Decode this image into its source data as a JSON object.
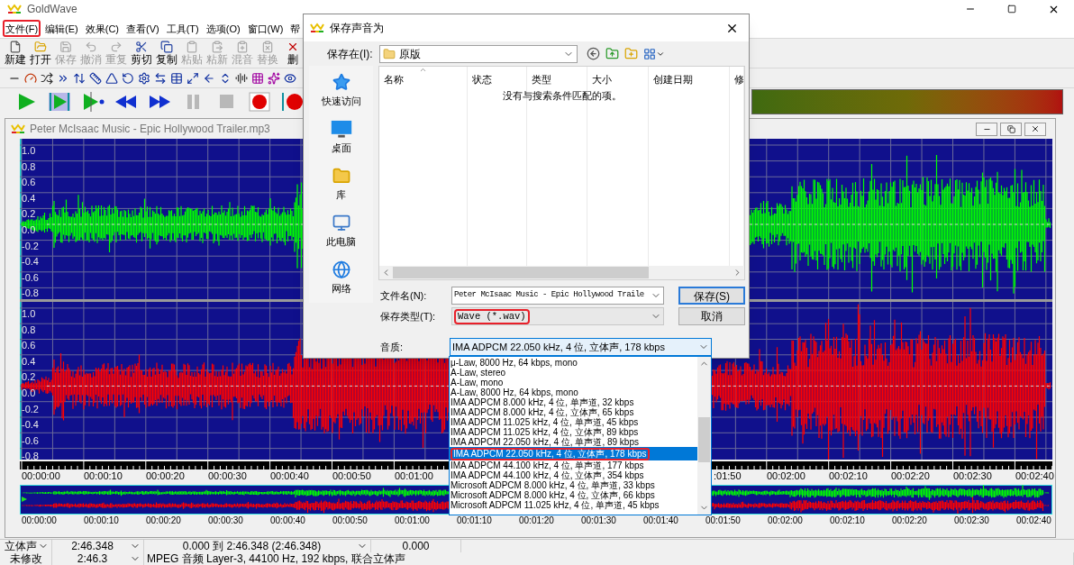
{
  "app": {
    "title": "GoldWave"
  },
  "menu": [
    {
      "label": "文件(F)",
      "circled": true
    },
    {
      "label": "编辑(E)",
      "circled": false
    },
    {
      "label": "效果(C)",
      "circled": false
    },
    {
      "label": "查看(V)",
      "circled": false
    },
    {
      "label": "工具(T)",
      "circled": false
    },
    {
      "label": "选项(O)",
      "circled": false
    },
    {
      "label": "窗口(W)",
      "circled": false
    },
    {
      "label": "帮",
      "circled": false
    }
  ],
  "toolbar": [
    {
      "label": "新建",
      "disabled": false
    },
    {
      "label": "打开",
      "disabled": false
    },
    {
      "label": "保存",
      "disabled": true
    },
    {
      "label": "撤消",
      "disabled": true
    },
    {
      "label": "重复",
      "disabled": true
    },
    {
      "label": "剪切",
      "disabled": false
    },
    {
      "label": "复制",
      "disabled": false
    },
    {
      "label": "粘贴",
      "disabled": true
    },
    {
      "label": "粘新",
      "disabled": true
    },
    {
      "label": "混音",
      "disabled": true
    },
    {
      "label": "替换",
      "disabled": true
    },
    {
      "label": "删",
      "disabled": false
    }
  ],
  "transport": [
    {
      "kind": "play",
      "disabled": false
    },
    {
      "kind": "play-selection",
      "disabled": false
    },
    {
      "kind": "play-from-cursor",
      "disabled": false
    },
    {
      "kind": "rewind",
      "disabled": false
    },
    {
      "kind": "fast-forward",
      "disabled": false
    },
    {
      "kind": "pause",
      "disabled": true
    },
    {
      "kind": "stop",
      "disabled": true
    },
    {
      "kind": "record",
      "disabled": false
    },
    {
      "kind": "record-selection",
      "disabled": false
    }
  ],
  "document": {
    "title": "Peter McIsaac Music - Epic Hollywood Trailer.mp3",
    "channels": [
      {
        "color": "#00ff00",
        "axis": [
          "1.0",
          "0.8",
          "0.6",
          "0.4",
          "0.2",
          "0.0",
          "-0.2",
          "-0.4",
          "-0.6",
          "-0.8"
        ]
      },
      {
        "color": "#ff0000",
        "axis": [
          "1.0",
          "0.8",
          "0.6",
          "0.4",
          "0.2",
          "0.0",
          "-0.2",
          "-0.4",
          "-0.6",
          "-0.8"
        ]
      }
    ],
    "timeline_left": [
      "00:00:00",
      "00:00:10",
      "00:00:20",
      "00:00:30",
      "00:00:40",
      "00:00:50",
      "00:01:00"
    ],
    "timeline_right": [
      ":01:50",
      "00:02:00",
      "00:02:10",
      "00:02:20",
      "00:02:30",
      "00:02:40"
    ],
    "overview_timeline": [
      "00:00:00",
      "00:00:10",
      "00:00:20",
      "00:00:30",
      "00:00:40",
      "00:00:50",
      "00:01:00",
      "00:01:10",
      "00:01:20",
      "00:01:30",
      "00:01:40",
      "00:01:50",
      "00:02:00",
      "00:02:10",
      "00:02:20",
      "00:02:30",
      "00:02:40"
    ]
  },
  "dialog": {
    "title": "保存声音为",
    "save_in": {
      "label": "保存在(I):",
      "value": "原版"
    },
    "places": [
      "快速访问",
      "桌面",
      "库",
      "此电脑",
      "网络"
    ],
    "columns": [
      "名称",
      "状态",
      "类型",
      "大小",
      "创建日期",
      "修"
    ],
    "empty_message": "没有与搜索条件匹配的项。",
    "file_name": {
      "label": "文件名(N):",
      "value": "Peter McIsaac Music - Epic Hollywood Traile"
    },
    "file_type": {
      "label": "保存类型(T):",
      "value": "Wave (*.wav)",
      "circled": true
    },
    "quality": {
      "label": "音质:",
      "value": "IMA ADPCM 22.050 kHz, 4 位, 立体声, 178 kbps"
    },
    "buttons": [
      {
        "label": "保存(S)",
        "default": true
      },
      {
        "label": "取消",
        "default": false
      }
    ],
    "quality_options": [
      {
        "label": "μ-Law, 8000 Hz, 64 kbps, mono",
        "selected": false,
        "circled": false
      },
      {
        "label": "A-Law, stereo",
        "selected": false,
        "circled": false
      },
      {
        "label": "A-Law, mono",
        "selected": false,
        "circled": false
      },
      {
        "label": "A-Law, 8000 Hz, 64 kbps, mono",
        "selected": false,
        "circled": false
      },
      {
        "label": "IMA ADPCM 8.000 kHz, 4 位, 单声道, 32 kbps",
        "selected": false,
        "circled": false
      },
      {
        "label": "IMA ADPCM 8.000 kHz, 4 位, 立体声, 65 kbps",
        "selected": false,
        "circled": false
      },
      {
        "label": "IMA ADPCM 11.025 kHz, 4 位, 单声道, 45 kbps",
        "selected": false,
        "circled": false
      },
      {
        "label": "IMA ADPCM 11.025 kHz, 4 位, 立体声, 89 kbps",
        "selected": false,
        "circled": false
      },
      {
        "label": "IMA ADPCM 22.050 kHz, 4 位, 单声道, 89 kbps",
        "selected": false,
        "circled": false
      },
      {
        "label": "IMA ADPCM 22.050 kHz, 4 位, 立体声, 178 kbps",
        "selected": true,
        "circled": true
      },
      {
        "label": "IMA ADPCM 44.100 kHz, 4 位, 单声道, 177 kbps",
        "selected": false,
        "circled": false
      },
      {
        "label": "IMA ADPCM 44.100 kHz, 4 位, 立体声, 354 kbps",
        "selected": false,
        "circled": false
      },
      {
        "label": "Microsoft ADPCM 8.000 kHz, 4 位, 单声道, 33 kbps",
        "selected": false,
        "circled": false
      },
      {
        "label": "Microsoft ADPCM 8.000 kHz, 4 位, 立体声, 66 kbps",
        "selected": false,
        "circled": false
      },
      {
        "label": "Microsoft ADPCM 11.025 kHz, 4 位, 单声道, 45 kbps",
        "selected": false,
        "circled": false
      }
    ]
  },
  "status_bar": {
    "row_1": [
      {
        "text": "立体声",
        "dropdown": true
      },
      {
        "text": "2:46.348",
        "dropdown": true
      },
      {
        "text": "0.000 到 2:46.348 (2:46.348)",
        "dropdown": true
      },
      {
        "text": "0.000",
        "dropdown": false
      }
    ],
    "row_2": [
      {
        "text": "未修改",
        "dropdown": false
      },
      {
        "text": "2:46.3",
        "dropdown": true
      },
      {
        "text": "MPEG 音频 Layer-3, 44100 Hz, 192 kbps, 联合立体声",
        "dropdown": false
      }
    ]
  }
}
